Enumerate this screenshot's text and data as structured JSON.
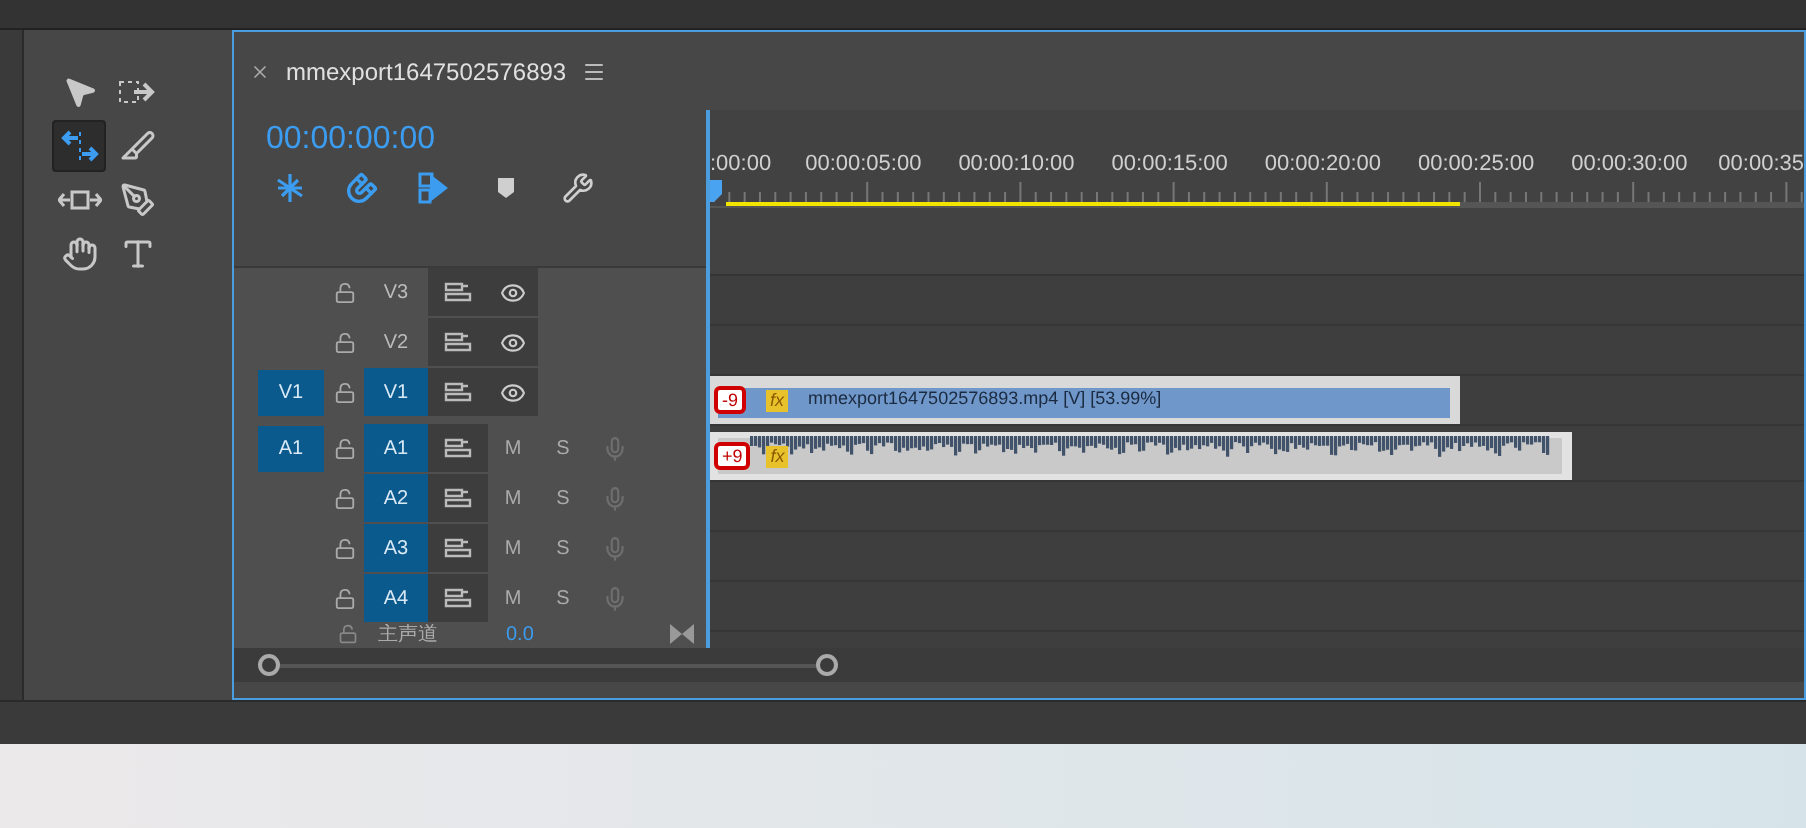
{
  "tools": [
    {
      "kind": "select",
      "selected": false
    },
    {
      "kind": "track-select",
      "selected": false
    },
    {
      "kind": "ripple",
      "selected": true
    },
    {
      "kind": "razor",
      "selected": false
    },
    {
      "kind": "slip",
      "selected": false
    },
    {
      "kind": "pen",
      "selected": false
    },
    {
      "kind": "hand",
      "selected": false
    },
    {
      "kind": "type",
      "selected": false
    }
  ],
  "sequence": {
    "title": "mmexport1647502576893",
    "timecode": "00:00:00:00",
    "toolbar": [
      {
        "kind": "nest",
        "on": true
      },
      {
        "kind": "snap",
        "on": true
      },
      {
        "kind": "linked",
        "on": true
      },
      {
        "kind": "marker",
        "on": false
      },
      {
        "kind": "settings",
        "on": false
      }
    ],
    "ruler": {
      "labels": [
        ":00:00",
        "00:00:05:00",
        "00:00:10:00",
        "00:00:15:00",
        "00:00:20:00",
        "00:00:25:00",
        "00:00:30:00",
        "00:00:35"
      ],
      "work_area": {
        "level": 0.68
      }
    },
    "tracks": [
      {
        "kind": "video",
        "name": "V3",
        "targeted": false
      },
      {
        "kind": "video",
        "name": "V2",
        "targeted": false
      },
      {
        "kind": "video",
        "name": "V1",
        "source": "V1",
        "targeted": true,
        "clip": {
          "badge": "-9",
          "fx": "fx",
          "label": "mmexport1647502576893.mp4 [V] [53.99%]"
        }
      },
      {
        "kind": "audio",
        "name": "A1",
        "source": "A1",
        "targeted": true,
        "mute": "M",
        "solo": "S",
        "clip": {
          "badge": "+9",
          "fx": "fx"
        }
      },
      {
        "kind": "audio",
        "name": "A2",
        "targeted": true,
        "mute": "M",
        "solo": "S"
      },
      {
        "kind": "audio",
        "name": "A3",
        "targeted": true,
        "mute": "M",
        "solo": "S"
      },
      {
        "kind": "audio",
        "name": "A4",
        "targeted": true,
        "mute": "M",
        "solo": "S"
      },
      {
        "kind": "master",
        "name": "主声道",
        "value": "0.0"
      }
    ]
  }
}
